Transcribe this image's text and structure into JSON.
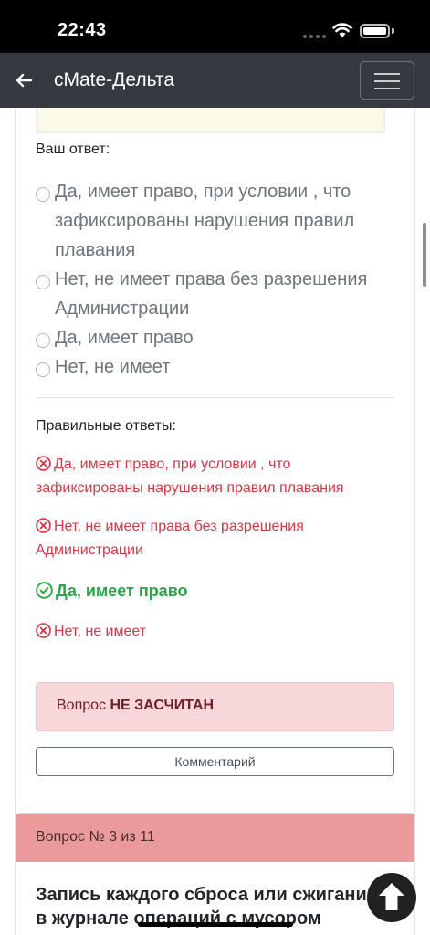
{
  "status_bar": {
    "time": "22:43"
  },
  "navbar": {
    "title": "cMate-Дельта",
    "back_icon": "arrow-left-icon",
    "menu_icon": "hamburger-icon"
  },
  "question": {
    "your_answer_label": "Ваш ответ:",
    "options": [
      {
        "line1": "Да, имеет право, при условии , что",
        "line2": "зафиксированы нарушения правил",
        "line3": "плавания"
      },
      {
        "line1": "Нет, не имеет права без разрешения",
        "line2": "Администрации"
      },
      {
        "line1": "Да, имеет право"
      },
      {
        "line1": "Нет, не имеет"
      }
    ],
    "correct_answers_label": "Правильные ответы:",
    "answers": [
      {
        "line1": "Да, имеет право, при условии , что",
        "line2": "зафиксированы нарушения правил плавания",
        "correct": false
      },
      {
        "line1": "Нет, не имеет права без разрешения",
        "line2": "Администрации",
        "correct": false
      },
      {
        "line1": "Да, имеет право",
        "correct": true
      },
      {
        "line1": "Нет, не имеет",
        "correct": false
      }
    ],
    "result_prefix": "Вопрос",
    "result_status": "НЕ ЗАСЧИТАН",
    "comment_button": "Комментарий"
  },
  "next_question": {
    "header": "Вопрос № 3 из 11",
    "text_line1": "Запись каждого сброса или сжигания",
    "text_line2": "в журнале операций с мусором"
  },
  "colors": {
    "navbar": "#343a40",
    "error": "#dc3545",
    "success": "#28a745",
    "alert_bg": "#f8d7da",
    "card_header": "#eb9a9b"
  }
}
